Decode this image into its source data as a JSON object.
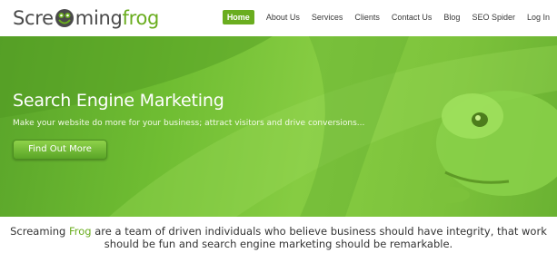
{
  "logo": {
    "part1": "Scre",
    "part2": "ming",
    "part3": "frog"
  },
  "nav": {
    "items": [
      {
        "label": "Home",
        "active": true
      },
      {
        "label": "About Us"
      },
      {
        "label": "Services"
      },
      {
        "label": "Clients"
      },
      {
        "label": "Contact Us"
      },
      {
        "label": "Blog"
      },
      {
        "label": "SEO Spider"
      },
      {
        "label": "Log In"
      }
    ]
  },
  "hero": {
    "title": "Search Engine Marketing",
    "subtitle": "Make your website do more for your business; attract visitors and drive conversions...",
    "button": "Find Out More"
  },
  "intro": {
    "before": "Screaming ",
    "highlight": "Frog",
    "after": " are a team of driven individuals who believe business should have integrity, that work should be fun and search engine marketing should be remarkable."
  },
  "colors": {
    "brand_green": "#6aad1f",
    "text_dark": "#333333"
  },
  "icons": [
    "frog-logo-icon"
  ]
}
